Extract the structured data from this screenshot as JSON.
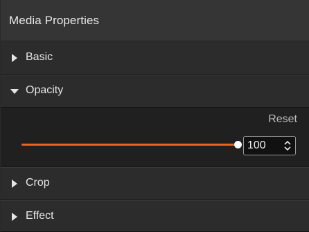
{
  "panel": {
    "title": "Media Properties"
  },
  "sections": {
    "basic": {
      "label": "Basic",
      "expanded": false
    },
    "opacity": {
      "label": "Opacity",
      "expanded": true
    },
    "crop": {
      "label": "Crop",
      "expanded": false
    },
    "effect": {
      "label": "Effect",
      "expanded": false
    }
  },
  "opacity_controls": {
    "reset_label": "Reset",
    "value": "100",
    "slider_fraction": 1.0
  },
  "colors": {
    "accent": "#e8631c",
    "panel_bg": "#1b1b1b",
    "header_bg": "#353535",
    "section_bg": "#2c2c2c"
  },
  "icons": {
    "collapsed": "triangle-right-icon",
    "expanded": "triangle-down-icon",
    "spin": "spin-arrows-icon"
  }
}
